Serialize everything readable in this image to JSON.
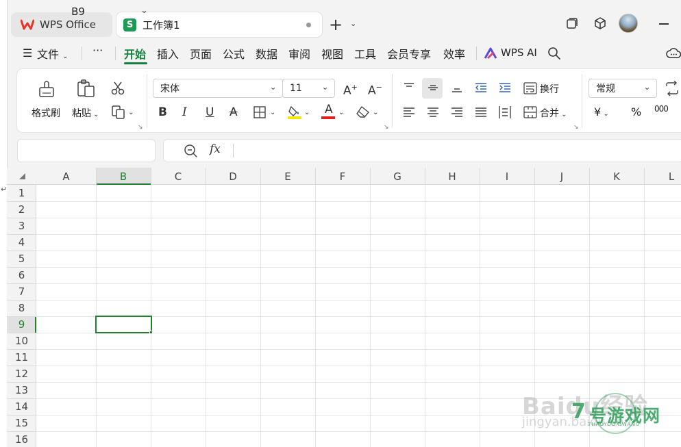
{
  "tabs": [
    {
      "label": "WPS Office",
      "icon": "wps-logo-icon"
    },
    {
      "label": "工作簿1",
      "icon": "spreadsheet-s-icon",
      "badge": "S",
      "active": true
    }
  ],
  "menu": {
    "file_label": "文件",
    "more_label": "···",
    "items": [
      "开始",
      "插入",
      "页面",
      "公式",
      "数据",
      "审阅",
      "视图",
      "工具",
      "会员专享",
      "效率"
    ],
    "active_item": "开始",
    "ai_label": "WPS AI"
  },
  "ribbon": {
    "format_painter_label": "格式刷",
    "paste_label": "粘贴",
    "font_name": "宋体",
    "font_size": "11",
    "wrap_label": "换行",
    "merge_label": "合并",
    "number_format": "常规",
    "currency_symbol": "¥",
    "percent_symbol": "%",
    "thousands_symbol": "000"
  },
  "formula_bar": {
    "cell_ref": "B9",
    "fx_label": "fx",
    "content": ""
  },
  "sheet": {
    "columns": [
      "A",
      "B",
      "C",
      "D",
      "E",
      "F",
      "G",
      "H",
      "I",
      "J",
      "K",
      "L"
    ],
    "rows": [
      "1",
      "2",
      "3",
      "4",
      "5",
      "6",
      "7",
      "8",
      "9",
      "10",
      "11",
      "12",
      "13",
      "14",
      "15",
      "16"
    ],
    "selected_cell": "B9",
    "accent_color": "#21822d"
  },
  "colors": {
    "brand_green": "#14803c",
    "wps_red": "#e8322b",
    "sheet_green": "#1a9a56"
  },
  "watermarks": {
    "baidu": "Baidu经验",
    "jingyan": "jingyan.baidu.com",
    "game_number": "7",
    "game_name": "号游戏网",
    "game_pinyin": "7HAOYOUXIWANG"
  }
}
